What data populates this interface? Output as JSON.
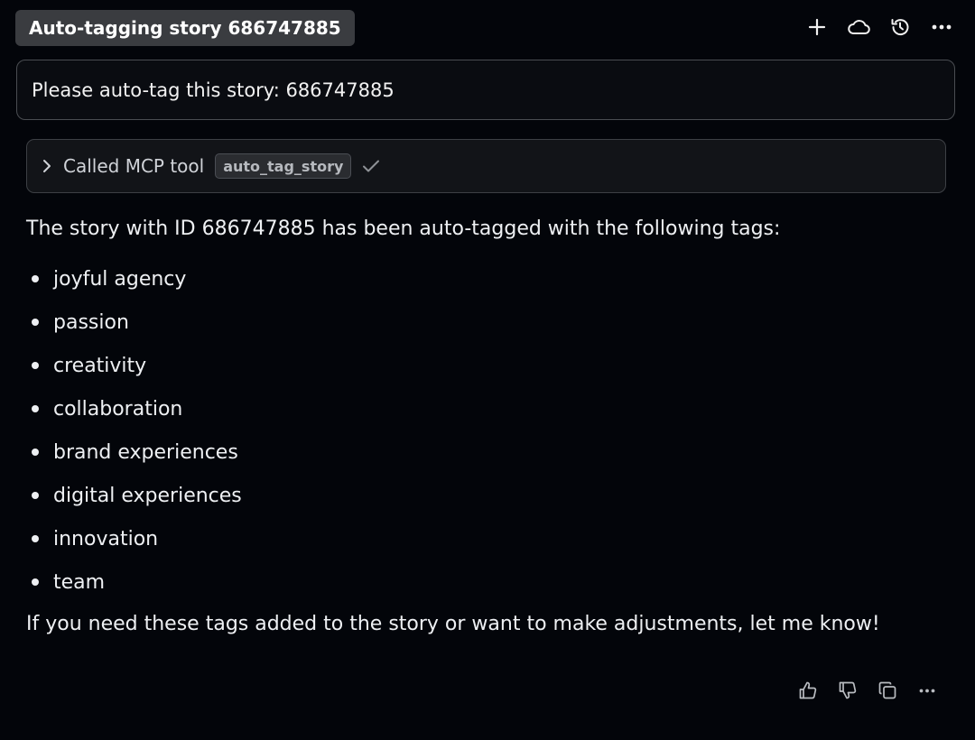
{
  "header": {
    "title": "Auto-tagging story 686747885",
    "actions": [
      {
        "name": "new-chat-button",
        "icon": "plus-icon"
      },
      {
        "name": "cloud-button",
        "icon": "cloud-icon"
      },
      {
        "name": "history-button",
        "icon": "history-icon"
      },
      {
        "name": "more-button",
        "icon": "more-horizontal-icon"
      }
    ]
  },
  "prompt": {
    "text": "Please auto-tag this story: 686747885"
  },
  "tool_call": {
    "label": "Called MCP tool",
    "tool_name": "auto_tag_story",
    "status_icon": "check-icon"
  },
  "response": {
    "intro": "The story with ID 686747885 has been auto-tagged with the following tags:",
    "tags": [
      "joyful agency",
      "passion",
      "creativity",
      "collaboration",
      "brand experiences",
      "digital experiences",
      "innovation",
      "team"
    ],
    "outro": "If you need these tags added to the story or want to make adjustments, let me know!"
  },
  "footer": {
    "actions": [
      {
        "name": "thumbs-up-button",
        "icon": "thumbs-up-icon"
      },
      {
        "name": "thumbs-down-button",
        "icon": "thumbs-down-icon"
      },
      {
        "name": "copy-button",
        "icon": "copy-icon"
      },
      {
        "name": "more-options-button",
        "icon": "more-horizontal-icon"
      }
    ]
  },
  "colors": {
    "background": "#03050a",
    "chip_background": "#3a3c40",
    "border": "#4a4d52",
    "text": "#eef0f3",
    "muted": "#b6b9be"
  }
}
